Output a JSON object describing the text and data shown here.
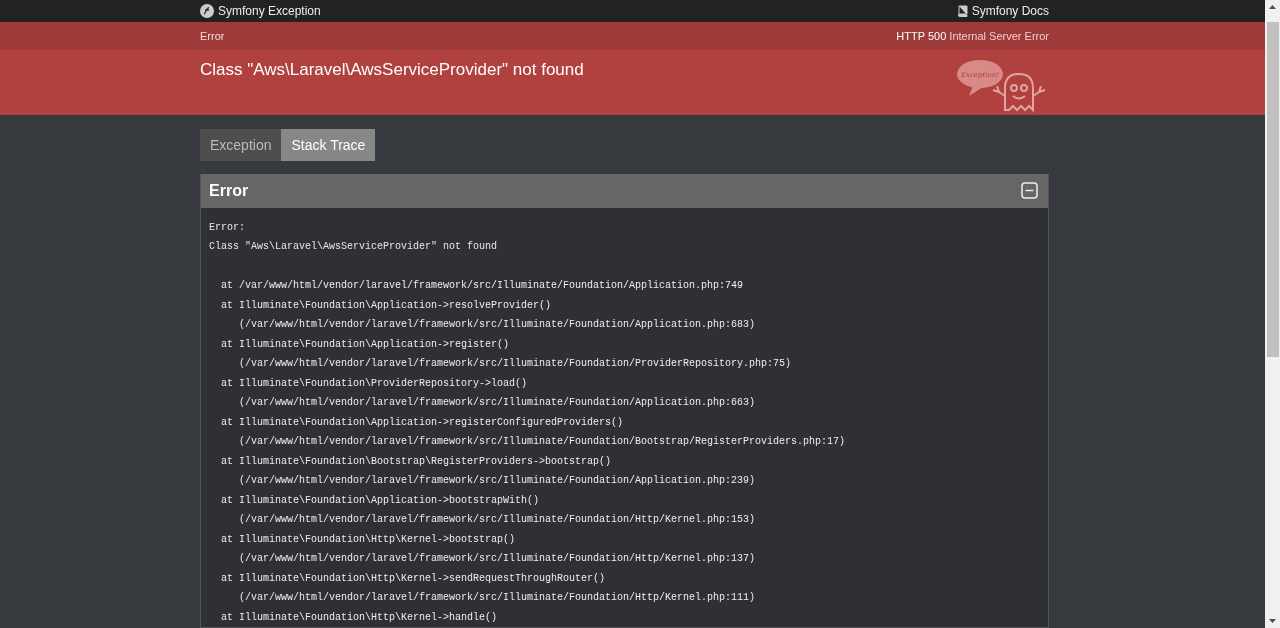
{
  "header": {
    "brand": "Symfony Exception",
    "docs_link": "Symfony Docs"
  },
  "status_bar": {
    "label": "Error",
    "code": "HTTP 500",
    "reason": "Internal Server Error"
  },
  "title": "Class \"Aws\\Laravel\\AwsServiceProvider\" not found",
  "illustration": {
    "bubble_text": "Exception!"
  },
  "tabs": [
    {
      "label": "Exception",
      "selected": false
    },
    {
      "label": "Stack Trace",
      "selected": true
    }
  ],
  "panel": {
    "title": "Error",
    "expanded": true,
    "message": [
      "Error:",
      "Class \"Aws\\Laravel\\AwsServiceProvider\" not found"
    ],
    "trace": [
      {
        "kind": "at",
        "text": "at /var/www/html/vendor/laravel/framework/src/Illuminate/Foundation/Application.php:749"
      },
      {
        "kind": "at",
        "text": "at Illuminate\\Foundation\\Application->resolveProvider()"
      },
      {
        "kind": "file",
        "text": "(/var/www/html/vendor/laravel/framework/src/Illuminate/Foundation/Application.php:683)"
      },
      {
        "kind": "at",
        "text": "at Illuminate\\Foundation\\Application->register()"
      },
      {
        "kind": "file",
        "text": "(/var/www/html/vendor/laravel/framework/src/Illuminate/Foundation/ProviderRepository.php:75)"
      },
      {
        "kind": "at",
        "text": "at Illuminate\\Foundation\\ProviderRepository->load()"
      },
      {
        "kind": "file",
        "text": "(/var/www/html/vendor/laravel/framework/src/Illuminate/Foundation/Application.php:663)"
      },
      {
        "kind": "at",
        "text": "at Illuminate\\Foundation\\Application->registerConfiguredProviders()"
      },
      {
        "kind": "file",
        "text": "(/var/www/html/vendor/laravel/framework/src/Illuminate/Foundation/Bootstrap/RegisterProviders.php:17)"
      },
      {
        "kind": "at",
        "text": "at Illuminate\\Foundation\\Bootstrap\\RegisterProviders->bootstrap()"
      },
      {
        "kind": "file",
        "text": "(/var/www/html/vendor/laravel/framework/src/Illuminate/Foundation/Application.php:239)"
      },
      {
        "kind": "at",
        "text": "at Illuminate\\Foundation\\Application->bootstrapWith()"
      },
      {
        "kind": "file",
        "text": "(/var/www/html/vendor/laravel/framework/src/Illuminate/Foundation/Http/Kernel.php:153)"
      },
      {
        "kind": "at",
        "text": "at Illuminate\\Foundation\\Http\\Kernel->bootstrap()"
      },
      {
        "kind": "file",
        "text": "(/var/www/html/vendor/laravel/framework/src/Illuminate/Foundation/Http/Kernel.php:137)"
      },
      {
        "kind": "at",
        "text": "at Illuminate\\Foundation\\Http\\Kernel->sendRequestThroughRouter()"
      },
      {
        "kind": "file",
        "text": "(/var/www/html/vendor/laravel/framework/src/Illuminate/Foundation/Http/Kernel.php:111)"
      },
      {
        "kind": "at",
        "text": "at Illuminate\\Foundation\\Http\\Kernel->handle()"
      }
    ]
  }
}
